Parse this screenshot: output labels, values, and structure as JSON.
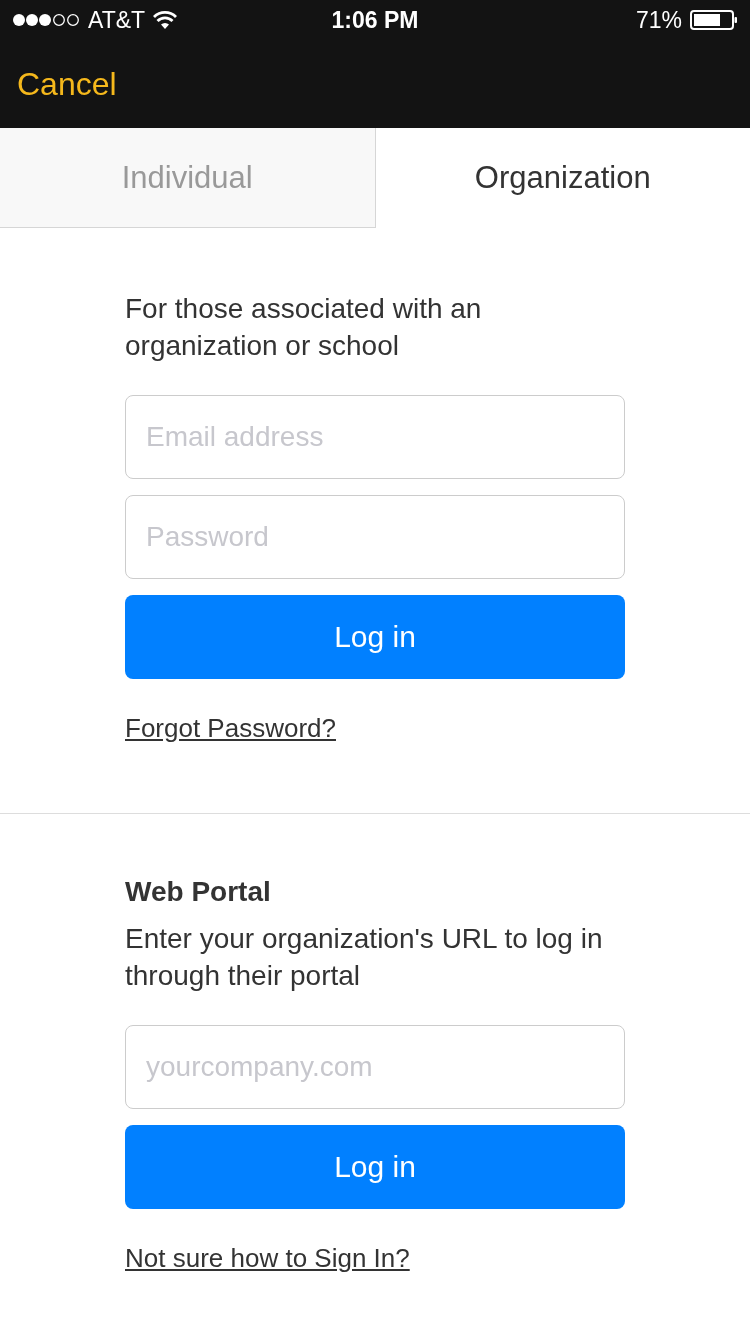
{
  "status_bar": {
    "carrier": "AT&T",
    "time": "1:06 PM",
    "battery": "71%"
  },
  "nav": {
    "cancel": "Cancel"
  },
  "tabs": [
    {
      "label": "Individual",
      "selected": false
    },
    {
      "label": "Organization",
      "selected": true
    }
  ],
  "org_login": {
    "intro": "For those associated with an organization or school",
    "email": {
      "placeholder": "Email address"
    },
    "password": {
      "placeholder": "Password"
    },
    "button": "Log in",
    "link": "Forgot Password?"
  },
  "web_portal": {
    "title": "Web Portal",
    "intro": "Enter your organization's URL to log in through their portal",
    "url": {
      "placeholder": "yourcompany.com"
    },
    "button": "Log in",
    "link": "Not sure how to Sign In?"
  }
}
